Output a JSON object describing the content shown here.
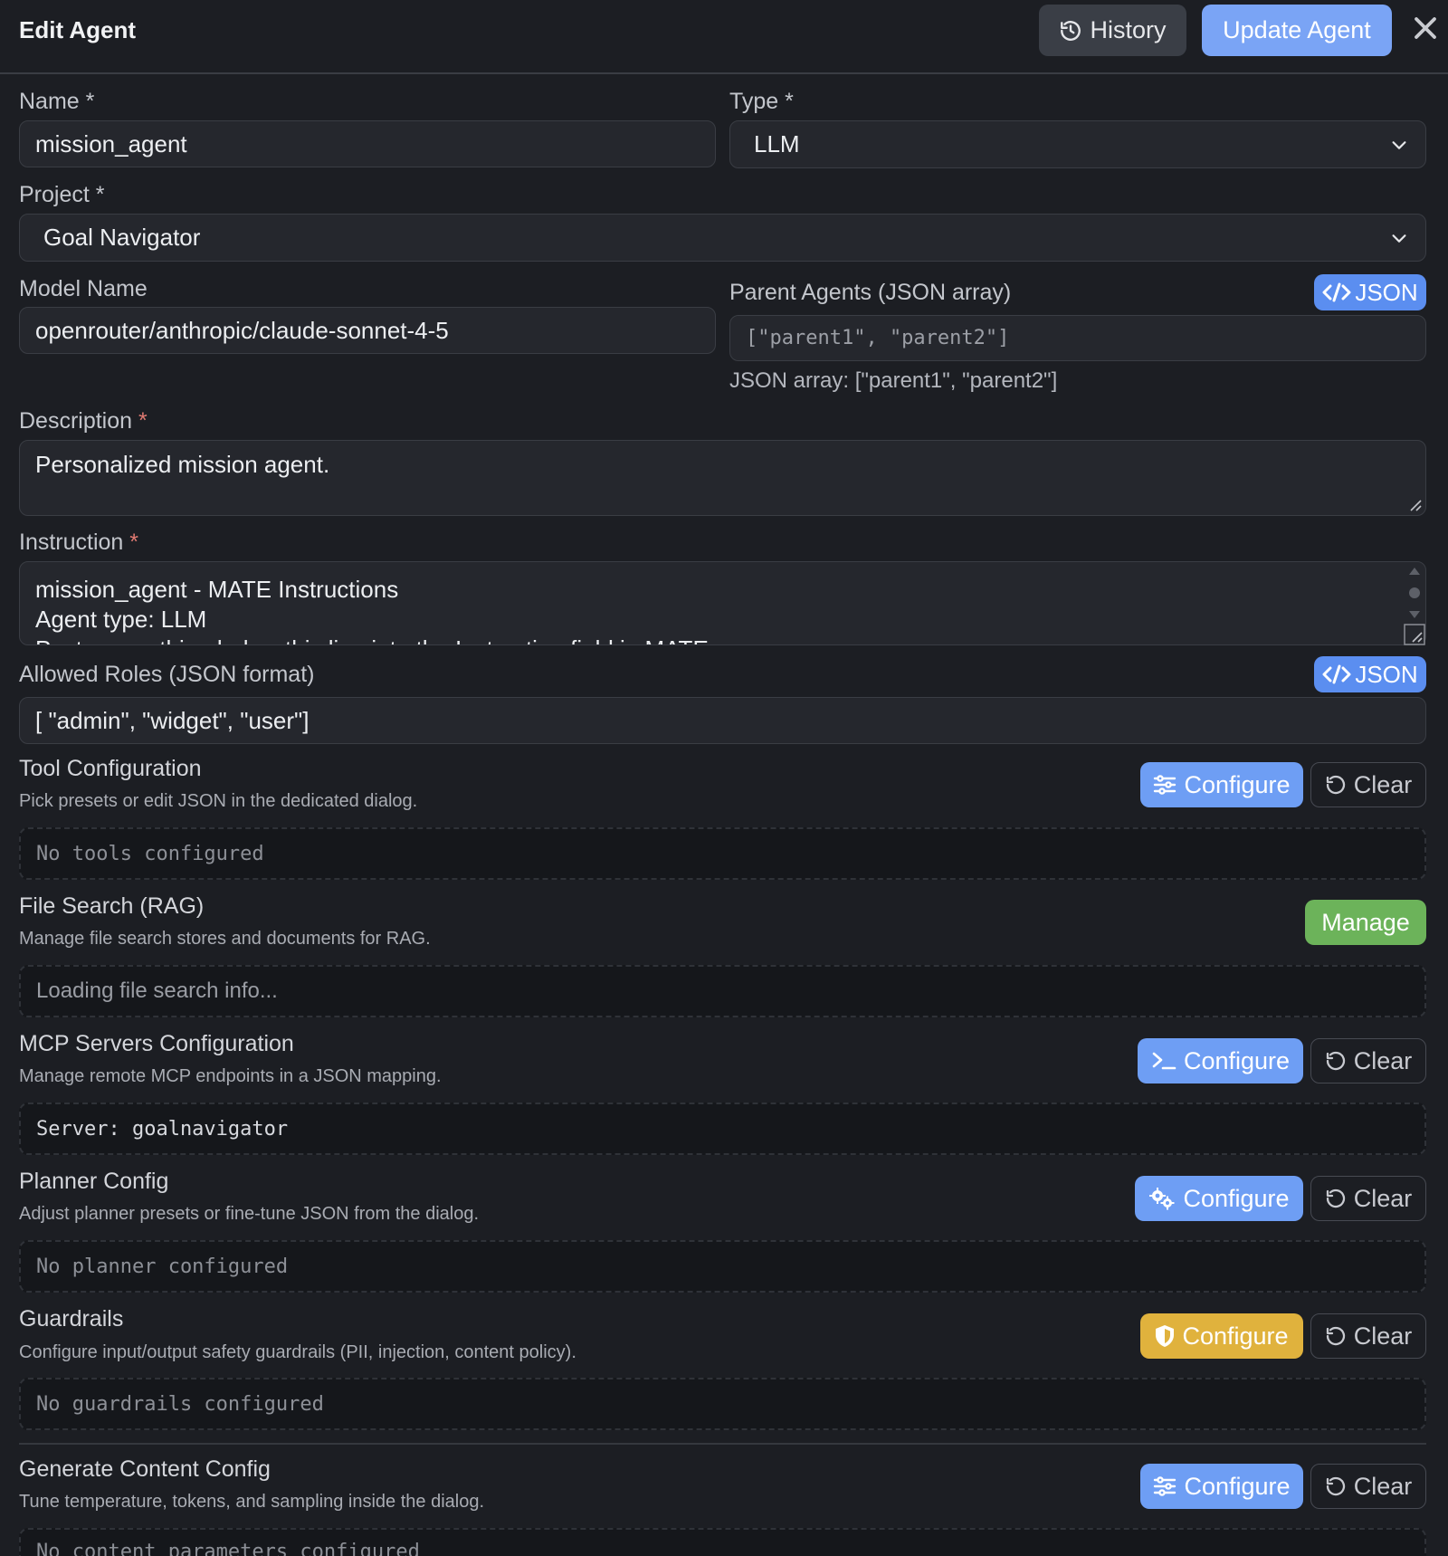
{
  "header": {
    "title": "Edit Agent",
    "history_label": "History",
    "update_label": "Update Agent"
  },
  "form": {
    "name": {
      "label": "Name *",
      "value": "mission_agent"
    },
    "type": {
      "label": "Type *",
      "value": "LLM"
    },
    "project": {
      "label": "Project *",
      "value": "Goal Navigator"
    },
    "model_name": {
      "label": "Model Name",
      "value": "openrouter/anthropic/claude-sonnet-4-5"
    },
    "parent_agents": {
      "label": "Parent Agents (JSON array)",
      "json_button": "JSON",
      "placeholder": "[\"parent1\", \"parent2\"]",
      "hint": "JSON array: [\"parent1\", \"parent2\"]"
    },
    "description": {
      "label": "Description",
      "required_mark": "*",
      "value": "Personalized mission agent."
    },
    "instruction": {
      "label": "Instruction",
      "required_mark": "*",
      "lines": [
        "mission_agent - MATE Instructions",
        "Agent type: LLM",
        "Paste everything below this line into the Instruction field in MATE"
      ]
    },
    "allowed_roles": {
      "label": "Allowed Roles (JSON format)",
      "json_button": "JSON",
      "value": "[ \"admin\", \"widget\", \"user\"]"
    }
  },
  "sections": {
    "tools": {
      "title": "Tool Configuration",
      "desc": "Pick presets or edit JSON in the dedicated dialog.",
      "configure": "Configure",
      "clear": "Clear",
      "content": "No tools configured"
    },
    "file_search": {
      "title": "File Search (RAG)",
      "desc": "Manage file search stores and documents for RAG.",
      "manage": "Manage",
      "content": "Loading file search info..."
    },
    "mcp": {
      "title": "MCP Servers Configuration",
      "desc": "Manage remote MCP endpoints in a JSON mapping.",
      "configure": "Configure",
      "clear": "Clear",
      "content": "Server: goalnavigator"
    },
    "planner": {
      "title": "Planner Config",
      "desc": "Adjust planner presets or fine-tune JSON from the dialog.",
      "configure": "Configure",
      "clear": "Clear",
      "content": "No planner configured"
    },
    "guardrails": {
      "title": "Guardrails",
      "desc": "Configure input/output safety guardrails (PII, injection, content policy).",
      "configure": "Configure",
      "clear": "Clear",
      "content": "No guardrails configured"
    },
    "generate": {
      "title": "Generate Content Config",
      "desc": "Tune temperature, tokens, and sampling inside the dialog.",
      "configure": "Configure",
      "clear": "Clear",
      "content": "No content parameters configured"
    }
  },
  "colors": {
    "background": "#1c1e23",
    "primary": "#6e9ef4",
    "manage_green": "#6cb35a",
    "guardrails_yellow": "#e0b23d"
  },
  "icons": [
    "history-icon",
    "close-icon",
    "chevron-down-icon",
    "code-icon",
    "sliders-icon",
    "terminal-icon",
    "gears-icon",
    "shield-icon",
    "undo-icon",
    "resize-grip-icon"
  ]
}
